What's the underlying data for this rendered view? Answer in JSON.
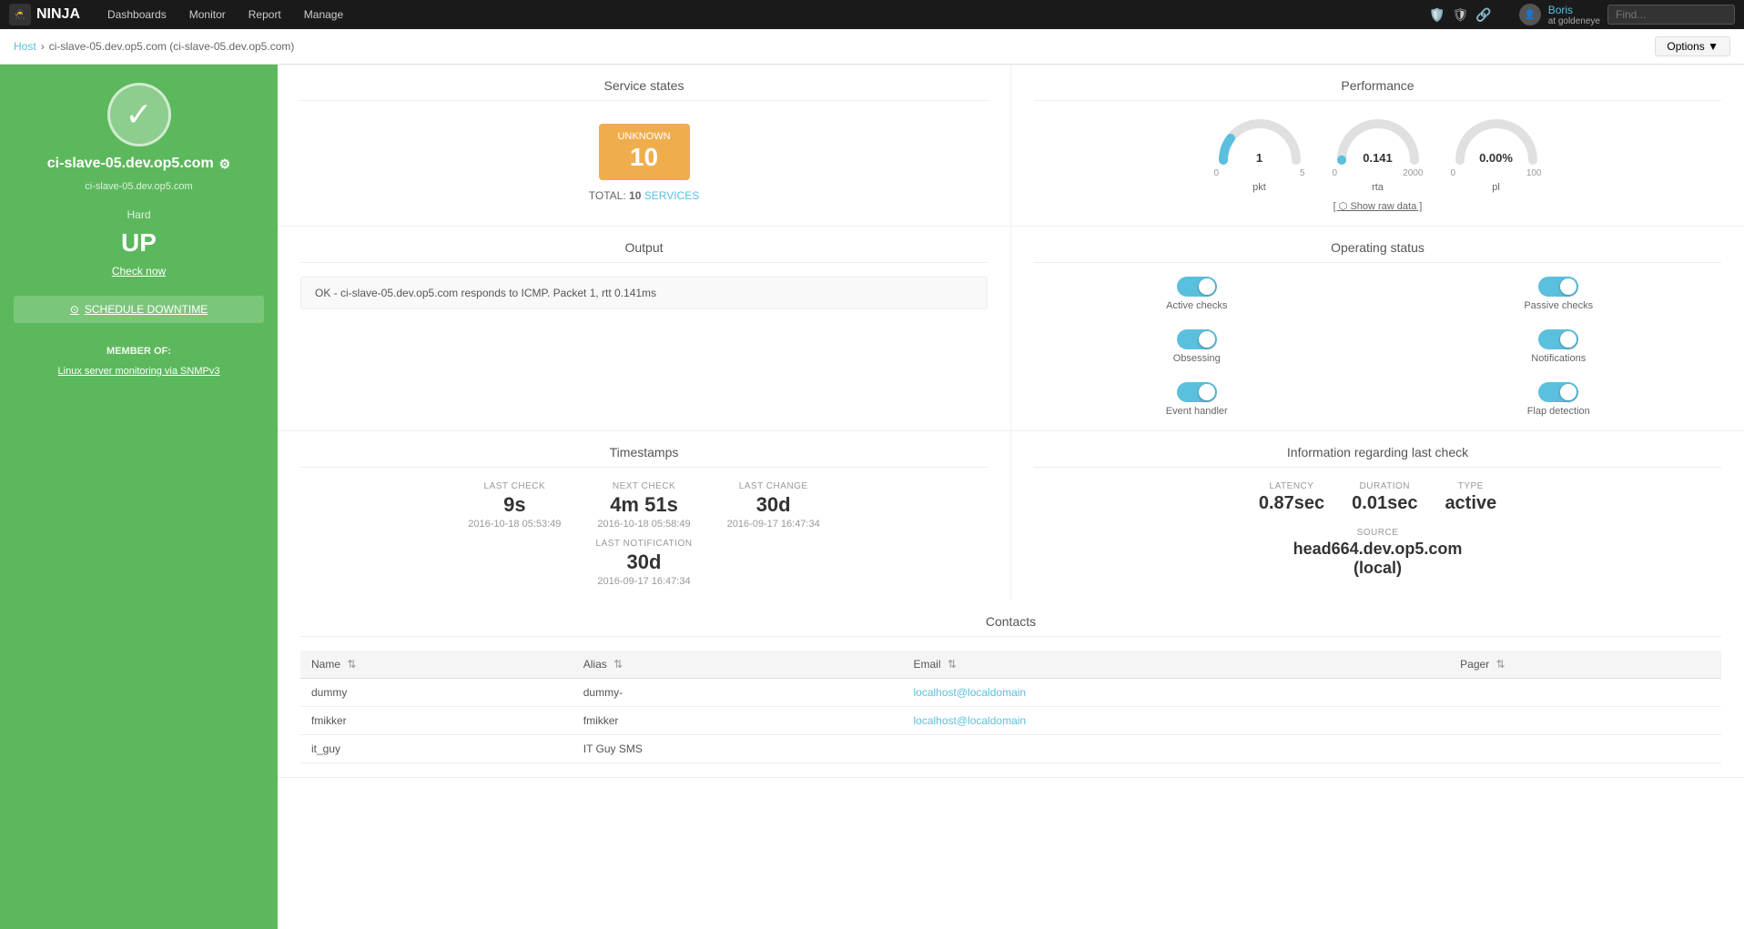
{
  "nav": {
    "logo": "NINJA",
    "items": [
      "Dashboards",
      "Monitor",
      "Report",
      "Manage"
    ]
  },
  "user": {
    "name": "Boris",
    "subtitle": "at goldeneye"
  },
  "search": {
    "placeholder": "Find..."
  },
  "breadcrumb": {
    "host": "Host",
    "path": "ci-slave-05.dev.op5.com (ci-slave-05.dev.op5.com)",
    "options": "Options ▼"
  },
  "sidebar": {
    "hostname": "ci-slave-05.dev.op5.com",
    "hostname_sub": "ci-slave-05.dev.op5.com",
    "check_type": "Hard",
    "status": "UP",
    "check_now": "Check now",
    "schedule_downtime": "SCHEDULE DOWNTIME",
    "member_of_label": "MEMBER OF:",
    "member_of_link": "Linux server monitoring via SNMPv3"
  },
  "service_states": {
    "title": "Service states",
    "unknown_label": "UNKNOWN",
    "unknown_count": "10",
    "total_label": "TOTAL:",
    "total_count": "10",
    "total_link": "SERVICES"
  },
  "performance": {
    "title": "Performance",
    "gauges": [
      {
        "id": "pkt",
        "label": "pkt",
        "value": "1",
        "min": "0",
        "max": "5",
        "fill_pct": 0.2
      },
      {
        "id": "rta",
        "label": "rta",
        "value": "0.141",
        "min": "0",
        "max": "2000",
        "fill_pct": 0.001
      },
      {
        "id": "pl",
        "label": "pl",
        "value": "0.00%",
        "min": "0",
        "max": "100",
        "fill_pct": 0.0
      }
    ],
    "show_raw": "[ ⬡ Show raw data ]"
  },
  "output": {
    "title": "Output",
    "text": "OK - ci-slave-05.dev.op5.com responds to ICMP. Packet 1, rtt 0.141ms"
  },
  "operating_status": {
    "title": "Operating status",
    "toggles": [
      {
        "id": "active-checks",
        "label": "Active checks",
        "on": true
      },
      {
        "id": "passive-checks",
        "label": "Passive checks",
        "on": true
      },
      {
        "id": "obsessing",
        "label": "Obsessing",
        "on": true
      },
      {
        "id": "notifications",
        "label": "Notifications",
        "on": true
      },
      {
        "id": "event-handler",
        "label": "Event handler",
        "on": true
      },
      {
        "id": "flap-detection",
        "label": "Flap detection",
        "on": true
      }
    ]
  },
  "timestamps": {
    "title": "Timestamps",
    "items": [
      {
        "id": "last-check",
        "label": "LAST CHECK",
        "value": "9s",
        "date": "2016-10-18 05:53:49"
      },
      {
        "id": "next-check",
        "label": "NEXT CHECK",
        "value": "4m 51s",
        "date": "2016-10-18 05:58:49"
      },
      {
        "id": "last-change",
        "label": "LAST CHANGE",
        "value": "30d",
        "date": "2016-09-17 16:47:34"
      },
      {
        "id": "last-notification",
        "label": "LAST NOTIFICATION",
        "value": "30d",
        "date": "2016-09-17 16:47:34"
      }
    ]
  },
  "last_check": {
    "title": "Information regarding last check",
    "latency_label": "LATENCY",
    "latency_value": "0.87sec",
    "duration_label": "DURATION",
    "duration_value": "0.01sec",
    "type_label": "TYPE",
    "type_value": "active",
    "source_label": "SOURCE",
    "source_value": "head664.dev.op5.com\n(local)"
  },
  "contacts": {
    "title": "Contacts",
    "columns": [
      "Name",
      "Alias",
      "Email",
      "Pager"
    ],
    "rows": [
      {
        "name": "dummy",
        "alias": "dummy-",
        "email": "localhost@localdomain",
        "pager": ""
      },
      {
        "name": "fmikker",
        "alias": "fmikker",
        "email": "localhost@localdomain",
        "pager": ""
      },
      {
        "name": "it_guy",
        "alias": "IT Guy SMS",
        "email": "",
        "pager": ""
      }
    ]
  }
}
